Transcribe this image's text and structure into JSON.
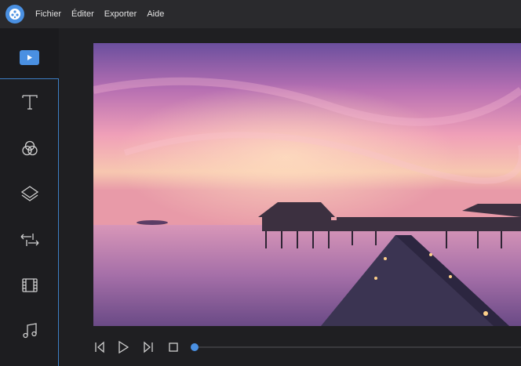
{
  "menu": {
    "items": [
      {
        "label": "Fichier"
      },
      {
        "label": "Éditer"
      },
      {
        "label": "Exporter"
      },
      {
        "label": "Aide"
      }
    ]
  },
  "sidebar": {
    "media_icon": "video-media-icon",
    "tools": [
      {
        "icon": "text-icon"
      },
      {
        "icon": "filters-icon"
      },
      {
        "icon": "overlays-icon"
      },
      {
        "icon": "transitions-icon"
      },
      {
        "icon": "film-elements-icon"
      },
      {
        "icon": "music-icon"
      }
    ]
  },
  "preview": {
    "image": "sunset-overwater-bungalows-boardwalk"
  },
  "playback": {
    "progress": 0
  },
  "colors": {
    "accent": "#4a90e2",
    "menubar": "#2a2a2d",
    "background": "#1f1f22"
  }
}
